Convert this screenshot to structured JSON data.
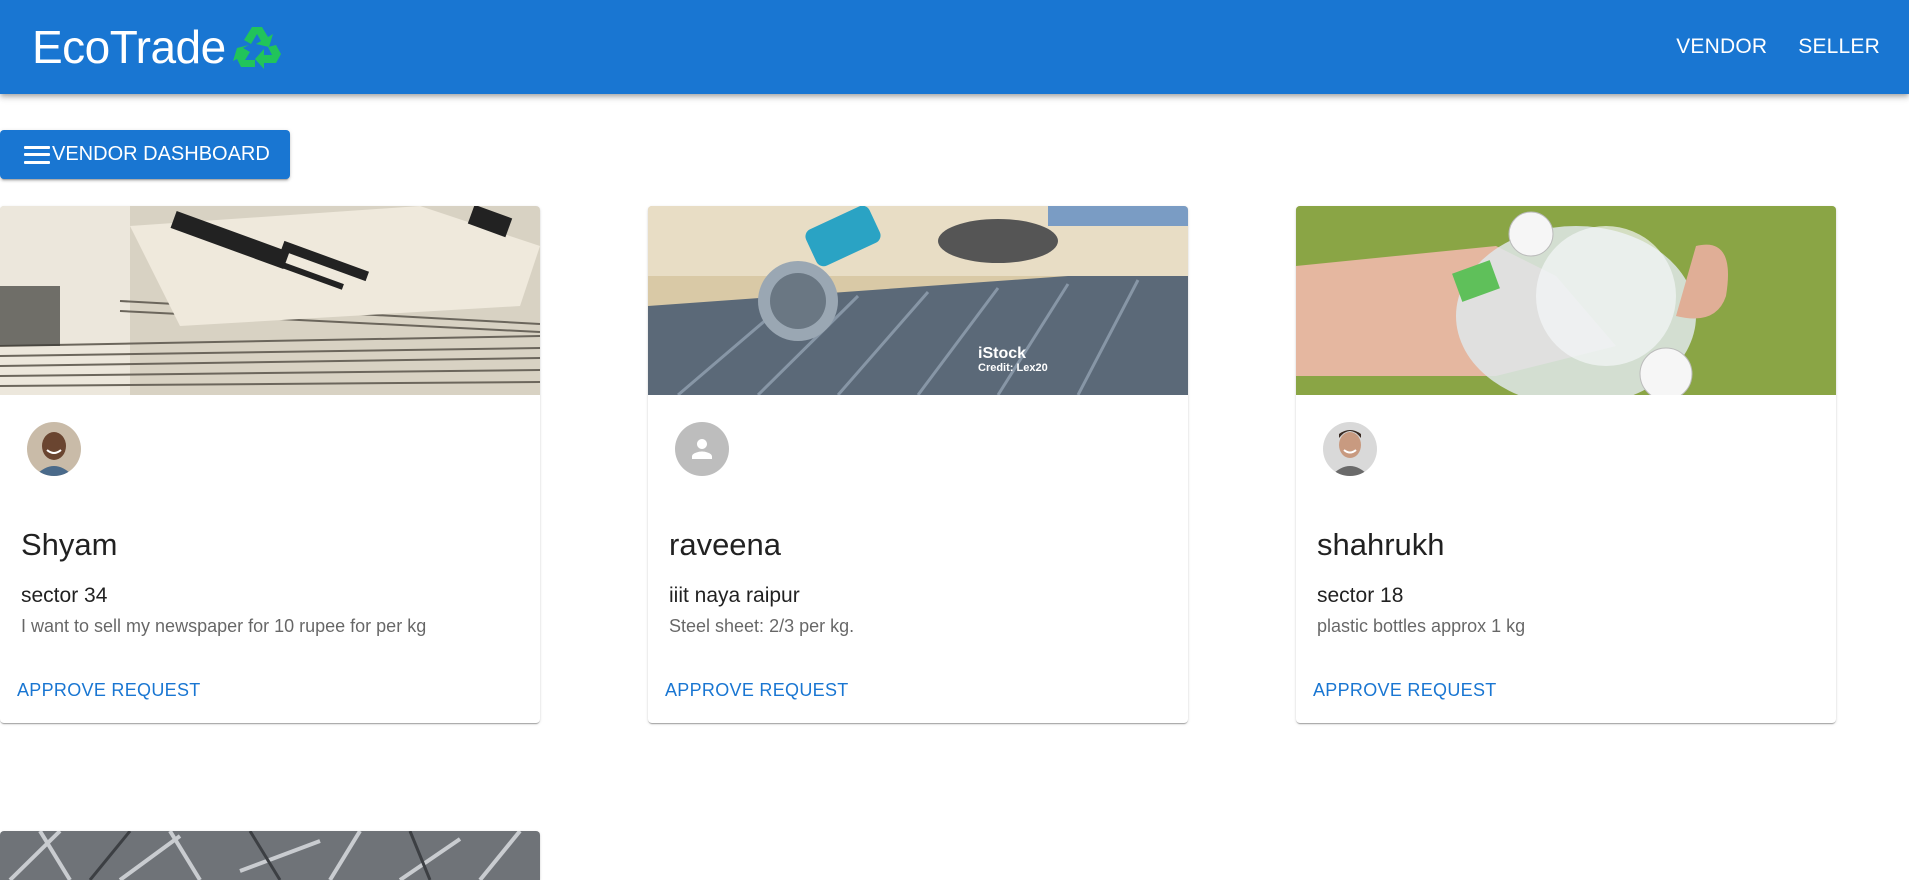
{
  "header": {
    "brand": "EcoTrade",
    "nav": [
      {
        "label": "VENDOR"
      },
      {
        "label": "SELLER"
      }
    ]
  },
  "dashboard_button": {
    "label": "VENDOR DASHBOARD"
  },
  "cards": [
    {
      "name": "Shyam",
      "location": "sector 34",
      "description": "I want to sell my newspaper for 10 rupee for per kg",
      "action": "APPROVE REQUEST"
    },
    {
      "name": "raveena",
      "location": "iiit naya raipur",
      "description": "Steel sheet: 2/3 per kg.",
      "action": "APPROVE REQUEST",
      "media_watermark": {
        "brand": "iStock",
        "credit": "Credit: Lex20"
      }
    },
    {
      "name": "shahrukh",
      "location": "sector 18",
      "description": "plastic bottles approx 1 kg",
      "action": "APPROVE REQUEST"
    }
  ],
  "colors": {
    "primary": "#1976d2",
    "recycle_green": "#22c55e"
  }
}
